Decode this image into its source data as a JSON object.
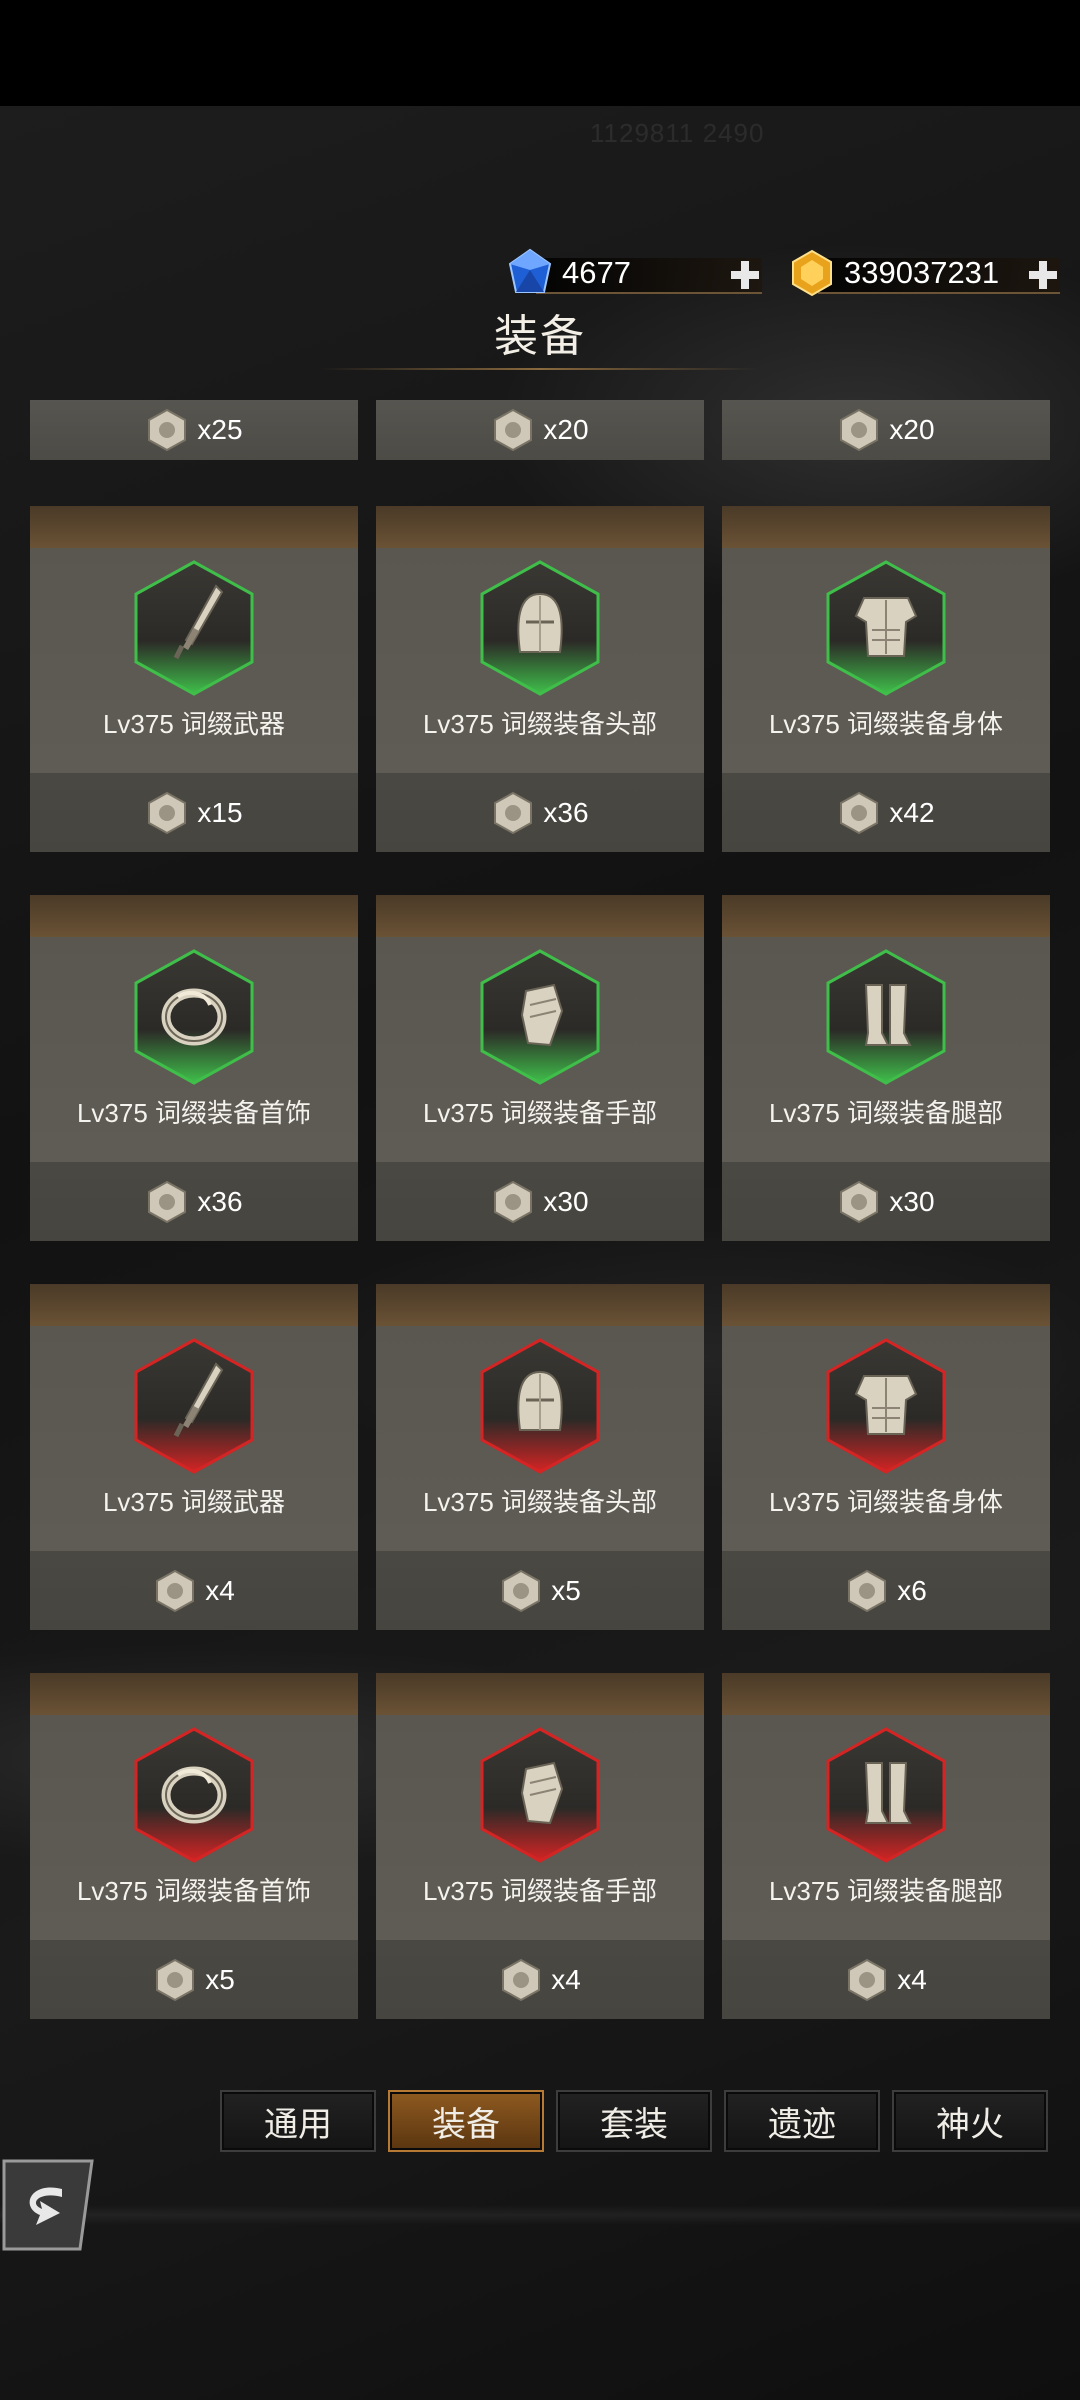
{
  "status_id": "1129811 2490",
  "currencies": {
    "gems": {
      "icon": "blue-gem-icon",
      "value": "4677"
    },
    "gold": {
      "icon": "gold-gem-icon",
      "value": "339037231"
    }
  },
  "title": "装备",
  "partial_row": [
    {
      "qty": "x25"
    },
    {
      "qty": "x20"
    },
    {
      "qty": "x20"
    }
  ],
  "cards": [
    {
      "name": "Lv375 词缀武器",
      "qty": "x15",
      "rarity": "green",
      "icon": "sword-icon"
    },
    {
      "name": "Lv375 词缀装备头部",
      "qty": "x36",
      "rarity": "green",
      "icon": "helmet-icon"
    },
    {
      "name": "Lv375 词缀装备身体",
      "qty": "x42",
      "rarity": "green",
      "icon": "armor-icon"
    },
    {
      "name": "Lv375 词缀装备首饰",
      "qty": "x36",
      "rarity": "green",
      "icon": "ring-icon"
    },
    {
      "name": "Lv375 词缀装备手部",
      "qty": "x30",
      "rarity": "green",
      "icon": "gauntlet-icon"
    },
    {
      "name": "Lv375 词缀装备腿部",
      "qty": "x30",
      "rarity": "green",
      "icon": "greaves-icon"
    },
    {
      "name": "Lv375 词缀武器",
      "qty": "x4",
      "rarity": "red",
      "icon": "sword-icon"
    },
    {
      "name": "Lv375 词缀装备头部",
      "qty": "x5",
      "rarity": "red",
      "icon": "helmet-icon"
    },
    {
      "name": "Lv375 词缀装备身体",
      "qty": "x6",
      "rarity": "red",
      "icon": "armor-icon"
    },
    {
      "name": "Lv375 词缀装备首饰",
      "qty": "x5",
      "rarity": "red",
      "icon": "ring-icon"
    },
    {
      "name": "Lv375 词缀装备手部",
      "qty": "x4",
      "rarity": "red",
      "icon": "gauntlet-icon"
    },
    {
      "name": "Lv375 词缀装备腿部",
      "qty": "x4",
      "rarity": "red",
      "icon": "greaves-icon"
    }
  ],
  "tabs": [
    {
      "label": "通用",
      "active": false
    },
    {
      "label": "装备",
      "active": true
    },
    {
      "label": "套装",
      "active": false
    },
    {
      "label": "遗迹",
      "active": false
    },
    {
      "label": "神火",
      "active": false
    }
  ],
  "colors": {
    "rarity_green": "#3fbf4a",
    "rarity_red": "#d42424",
    "tab_active": "#8e5a20"
  }
}
